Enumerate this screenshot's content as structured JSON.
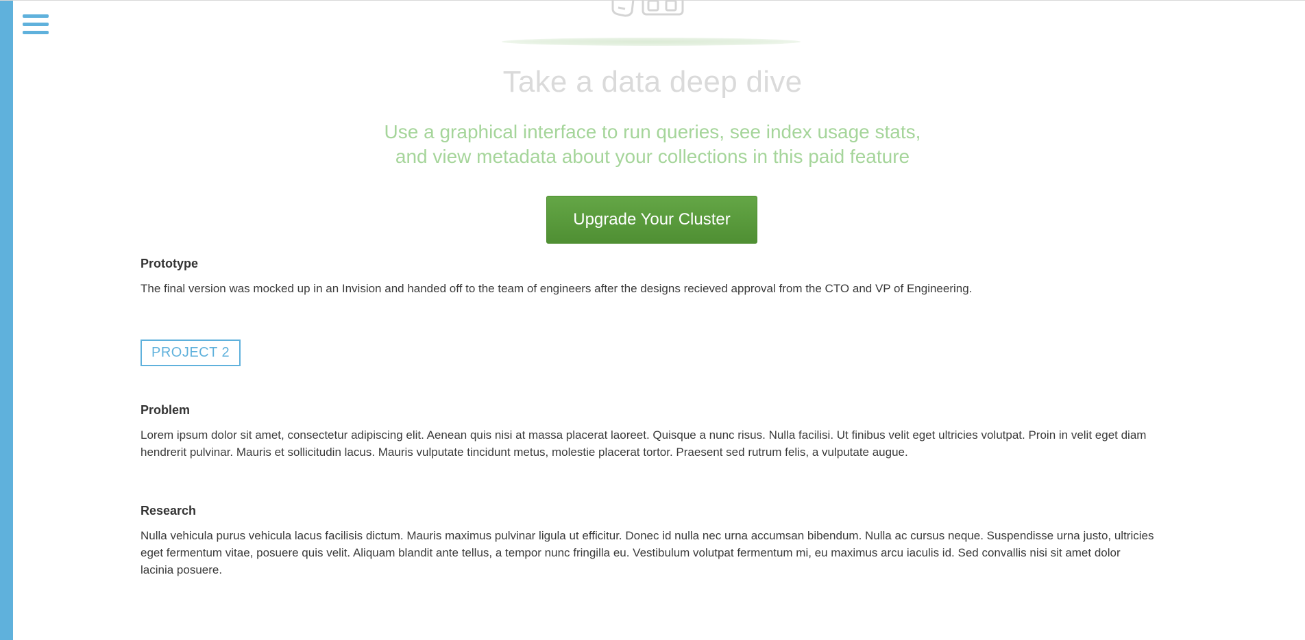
{
  "nav": {
    "menu_icon": "hamburger-menu-icon"
  },
  "mockup": {
    "title": "Take a data deep dive",
    "subtitle_line1": "Use a graphical interface to run queries, see index usage stats,",
    "subtitle_line2": "and view metadata about your collections in this paid feature",
    "button_label": "Upgrade Your Cluster",
    "icons": "document-and-grid-icons",
    "colors": {
      "button": "#5a9c3d",
      "subtitle": "#a5d59a",
      "title": "#dadada"
    }
  },
  "sections": {
    "prototype": {
      "heading": "Prototype",
      "body": "The final version was mocked up in an Invision and handed off to the team of engineers after the designs recieved approval from the CTO and VP of Engineering."
    },
    "project_tag": "PROJECT 2",
    "problem": {
      "heading": "Problem",
      "body": "Lorem ipsum dolor sit amet, consectetur adipiscing elit. Aenean quis nisi at massa placerat laoreet. Quisque a nunc risus. Nulla facilisi. Ut finibus velit eget ultricies volutpat. Proin in velit eget diam hendrerit pulvinar. Mauris et sollicitudin lacus. Mauris vulputate tincidunt metus, molestie placerat tortor. Praesent sed rutrum felis, a vulputate augue."
    },
    "research": {
      "heading": "Research",
      "body": "Nulla vehicula purus vehicula lacus facilisis dictum. Mauris maximus pulvinar ligula ut efficitur. Donec id nulla nec urna accumsan bibendum. Nulla ac cursus neque. Suspendisse urna justo, ultricies eget fermentum vitae, posuere quis velit. Aliquam blandit ante tellus, a tempor nunc fringilla eu. Vestibulum volutpat fermentum mi, eu maximus arcu iaculis id. Sed convallis nisi sit amet dolor lacinia posuere."
    }
  },
  "theme": {
    "accent": "#5fb1dc"
  }
}
